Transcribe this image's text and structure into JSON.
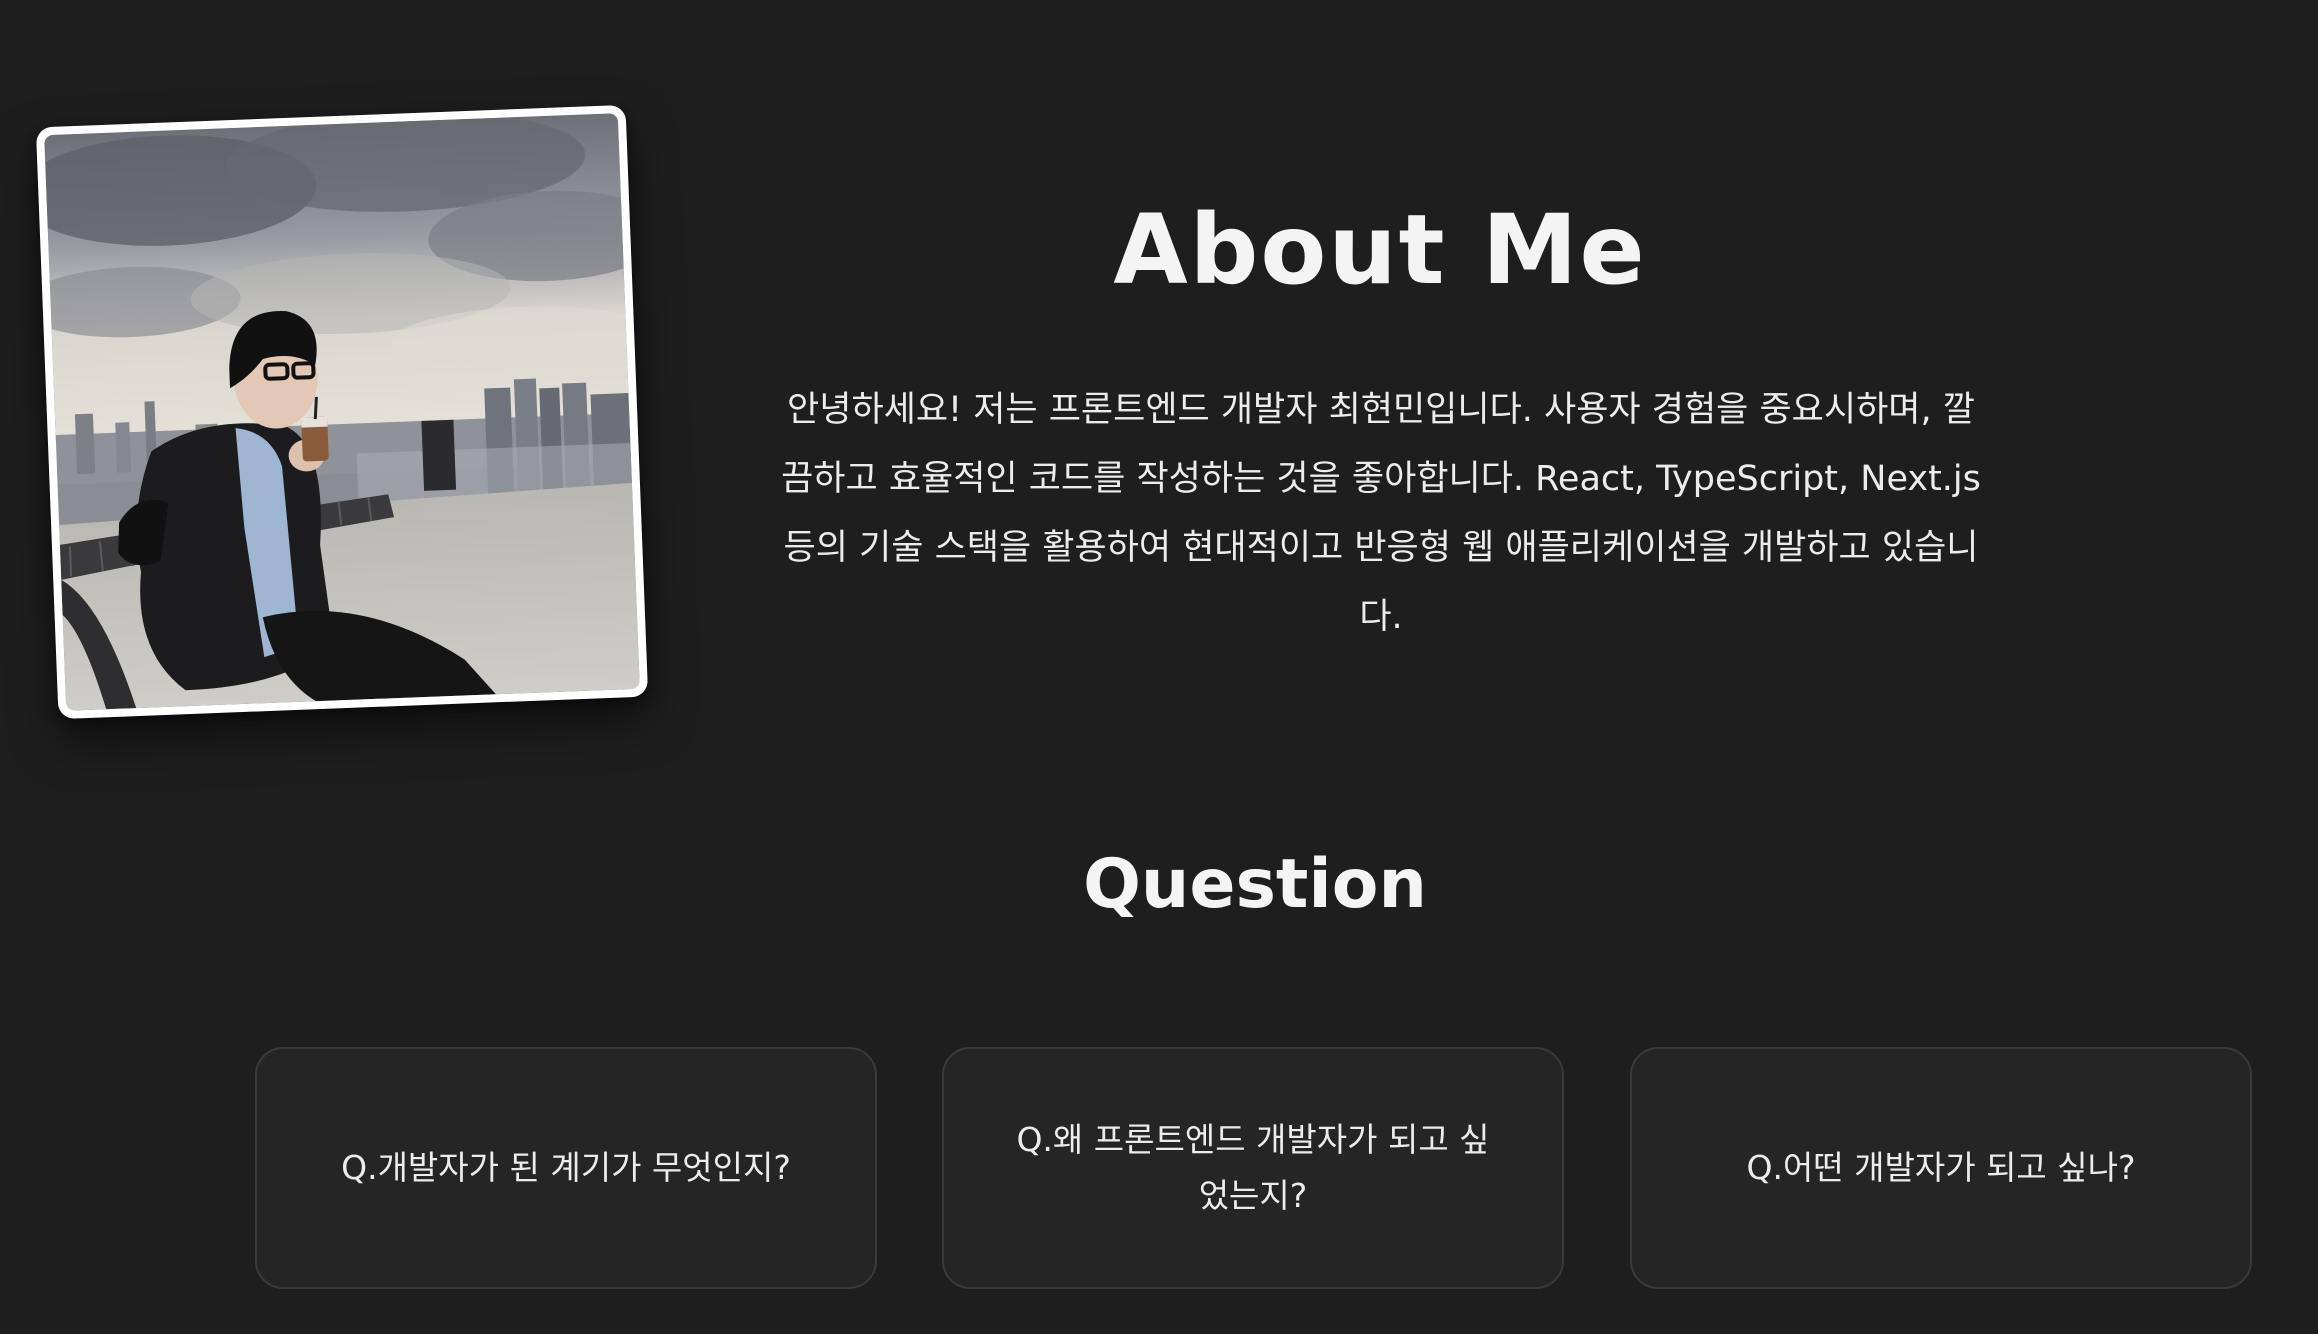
{
  "about": {
    "title": "About Me",
    "description": "안녕하세요! 저는 프론트엔드 개발자 최현민입니다. 사용자 경험을 중요시하며, 깔끔하고 효율적인 코드를 작성하는 것을 좋아합니다. React, TypeScript, Next.js 등의 기술 스택을 활용하여 현대적이고 반응형 웹 애플리케이션을 개발하고 있습니다."
  },
  "question": {
    "title": "Question",
    "cards": [
      {
        "label": "Q.개발자가 된 계기가 무엇인지?"
      },
      {
        "label": "Q.왜 프론트엔드 개발자가 되고 싶었는지?"
      },
      {
        "label": "Q.어떤 개발자가 되고 싶나?"
      }
    ]
  },
  "colors": {
    "background": "#1e1e1e",
    "card_background": "#252525",
    "card_border": "#3a3a3a",
    "text": "#f2f2f2"
  }
}
